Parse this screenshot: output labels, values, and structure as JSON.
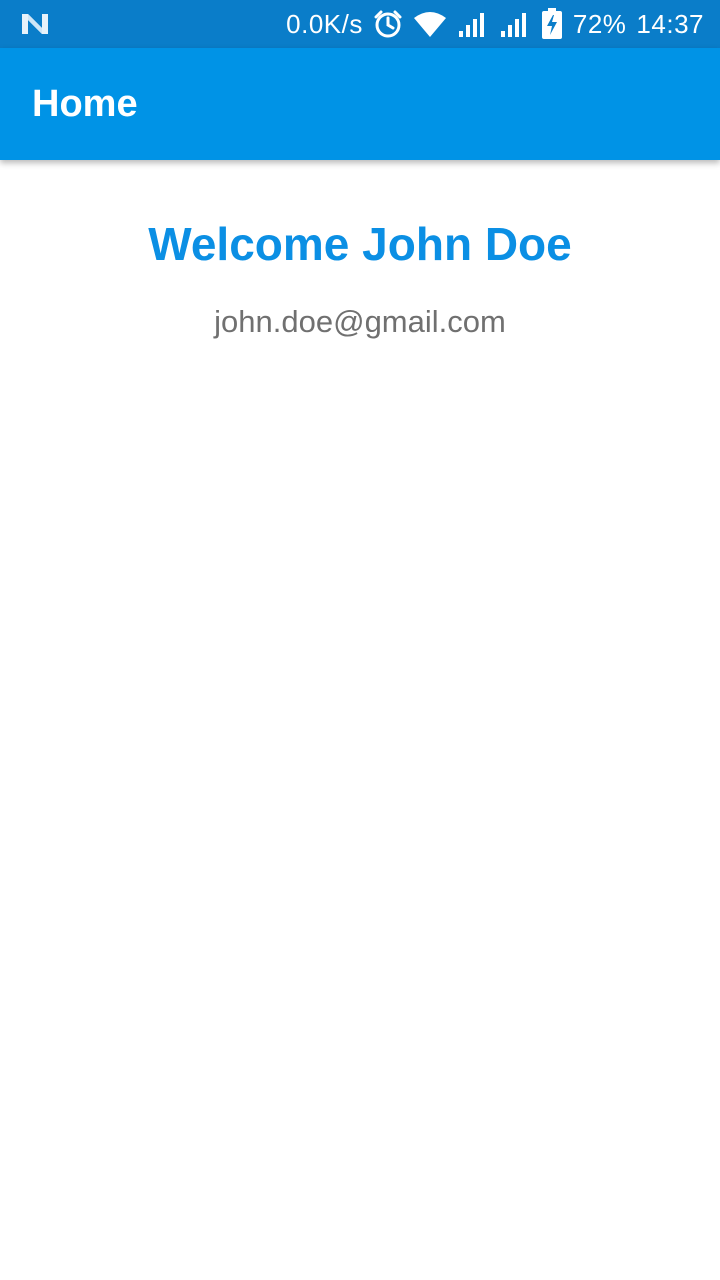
{
  "status_bar": {
    "notification_icon": "n-notification-icon",
    "network_speed": "0.0K/s",
    "alarm_icon": "alarm-icon",
    "wifi_icon": "wifi-icon",
    "signal_icon_1": "signal-icon",
    "signal_icon_2": "signal-icon",
    "battery_icon": "battery-charging-icon",
    "battery_percent": "72%",
    "time": "14:37",
    "background_color": "#0a7dc9"
  },
  "app_bar": {
    "title": "Home",
    "background_color": "#0093e6"
  },
  "main": {
    "welcome_text": "Welcome John Doe",
    "email": "john.doe@gmail.com",
    "welcome_color": "#0b8fe4",
    "email_color": "#707070"
  }
}
